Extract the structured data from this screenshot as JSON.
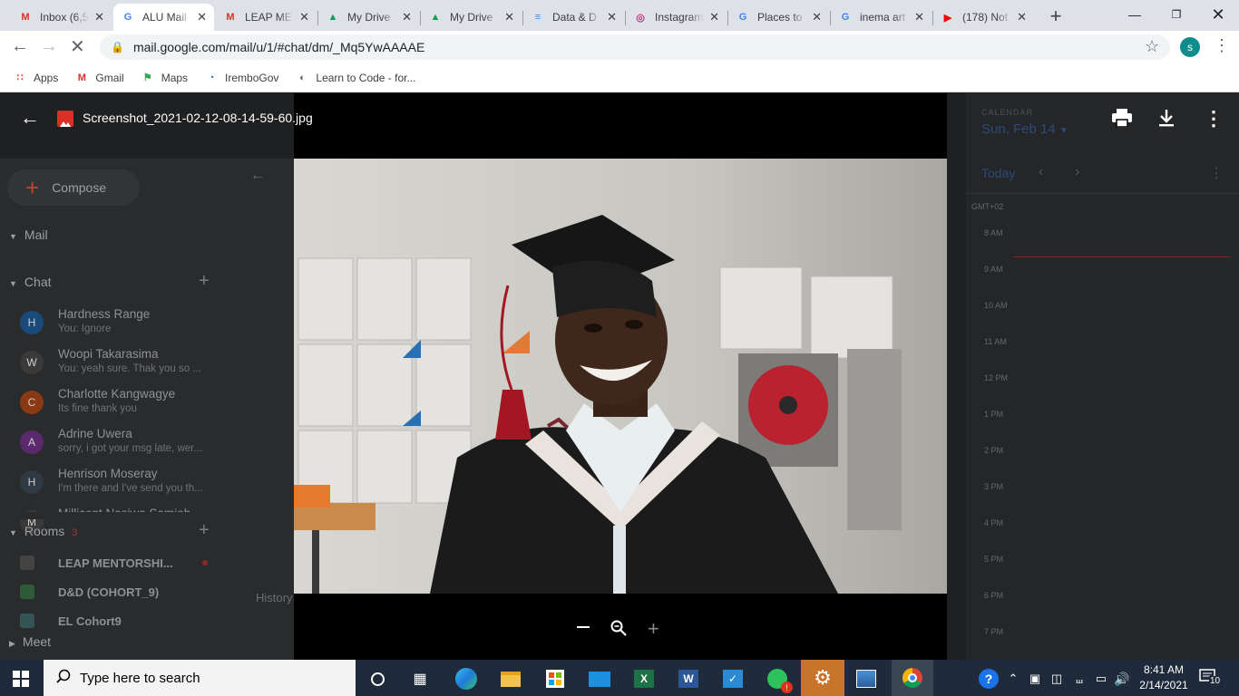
{
  "browser": {
    "tabs": [
      {
        "title": "Inbox (6,5",
        "icon": "gmail-icon",
        "active": false
      },
      {
        "title": "ALU Mail",
        "icon": "google-icon",
        "active": true
      },
      {
        "title": "LEAP ME",
        "icon": "gmail-icon",
        "active": false
      },
      {
        "title": "My Drive",
        "icon": "drive-icon",
        "active": false
      },
      {
        "title": "My Drive",
        "icon": "drive-icon",
        "active": false
      },
      {
        "title": "Data & D",
        "icon": "docs-icon",
        "active": false
      },
      {
        "title": "Instagram",
        "icon": "instagram-icon",
        "active": false
      },
      {
        "title": "Places to",
        "icon": "google-icon",
        "active": false
      },
      {
        "title": "inema art",
        "icon": "google-icon",
        "active": false
      },
      {
        "title": "(178) Not",
        "icon": "youtube-icon",
        "active": false
      }
    ],
    "url": "mail.google.com/mail/u/1/#chat/dm/_Mq5YwAAAAE",
    "profile_initial": "s",
    "bookmarks": [
      {
        "label": "Apps",
        "icon": "apps-grid-icon"
      },
      {
        "label": "Gmail",
        "icon": "gmail-icon"
      },
      {
        "label": "Maps",
        "icon": "maps-icon"
      },
      {
        "label": "IremboGov",
        "icon": "irembo-icon"
      },
      {
        "label": "Learn to Code - for...",
        "icon": "globe-icon"
      }
    ]
  },
  "viewer": {
    "filename": "Screenshot_2021-02-12-08-14-59-60.jpg"
  },
  "gmail": {
    "compose_label": "Compose",
    "mail_label": "Mail",
    "chat_label": "Chat",
    "chats": [
      {
        "initial": "H",
        "name": "Hardness Range",
        "preview": "You: Ignore",
        "color": "#1a4a7a"
      },
      {
        "initial": "W",
        "name": "Woopi Takarasima",
        "preview": "You: yeah sure. Thak you so ...",
        "color": "#3a3a3a"
      },
      {
        "initial": "C",
        "name": "Charlotte Kangwagye",
        "preview": "Its fine thank you",
        "color": "#8a3a12"
      },
      {
        "initial": "A",
        "name": "Adrine Uwera",
        "preview": "sorry, i got your msg late, wer...",
        "color": "#5b2a6e"
      },
      {
        "initial": "H",
        "name": "Henrison Moseray",
        "preview": "I'm there and I've send you th...",
        "color": "#2f3a44"
      },
      {
        "initial": "M",
        "name": "Millicent Nasiwa Samiah",
        "preview": "",
        "color": "#3a3a3a"
      }
    ],
    "rooms_label": "Rooms",
    "rooms_count": "3",
    "rooms": [
      {
        "name": "LEAP MENTORSHI...",
        "color": "#444"
      },
      {
        "name": "D&D (COHORT_9)",
        "color": "#2f5a3a"
      },
      {
        "name": "EL Cohort9",
        "color": "#355"
      }
    ],
    "meet_label": "Meet",
    "history_label": "History"
  },
  "calendar": {
    "section_label": "CALENDAR",
    "date_label": "Sun, Feb 14",
    "today_label": "Today",
    "timezone": "GMT+02",
    "hours": [
      "8 AM",
      "9 AM",
      "10 AM",
      "11 AM",
      "12 PM",
      "1 PM",
      "2 PM",
      "3 PM",
      "4 PM",
      "5 PM",
      "6 PM",
      "7 PM"
    ]
  },
  "taskbar": {
    "search_placeholder": "Type here to search",
    "time": "8:41 AM",
    "date": "2/14/2021",
    "notification_count": "10"
  },
  "colors": {
    "chrome_tabstrip": "#dee1e6",
    "viewer_bg": "#000000",
    "taskbar_bg": "#1f2b3a",
    "settings_tile": "#c8742a",
    "profile_avatar": "#0f8c8c"
  }
}
